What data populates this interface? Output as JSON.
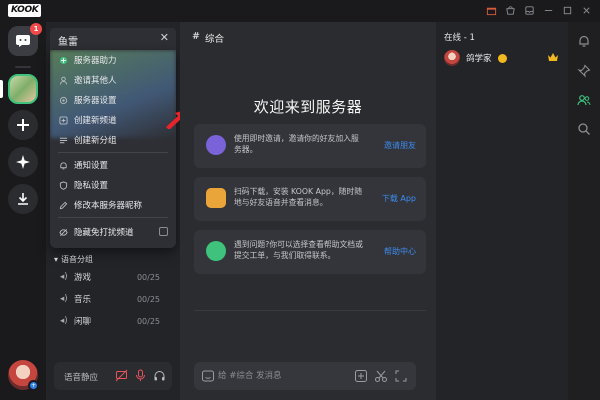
{
  "app": {
    "logo": "KOOK"
  },
  "colors": {
    "accent": "#3c8cf0",
    "online": "#3ec27c",
    "alert": "#f2494b",
    "arrow": "#e8232a"
  },
  "rail": {
    "chat_badge": "1"
  },
  "server": {
    "name": "鱼雷"
  },
  "server_menu": {
    "items": [
      {
        "label": "服务器助力",
        "icon": "boost-icon"
      },
      {
        "label": "邀请其他人",
        "icon": "invite-icon"
      },
      {
        "label": "服务器设置",
        "icon": "settings-icon"
      },
      {
        "label": "创建新频道",
        "icon": "add-channel-icon"
      },
      {
        "label": "创建新分组",
        "icon": "add-group-icon"
      },
      {
        "label": "通知设置",
        "icon": "bell-icon"
      },
      {
        "label": "隐私设置",
        "icon": "shield-icon"
      },
      {
        "label": "修改本服务器昵称",
        "icon": "edit-icon"
      },
      {
        "label": "隐藏免打扰频道",
        "icon": "eye-off-icon"
      }
    ]
  },
  "voice_group": {
    "title": "语音分组",
    "channels": [
      {
        "name": "游戏",
        "count": "00/25"
      },
      {
        "name": "音乐",
        "count": "00/25"
      },
      {
        "name": "闲聊",
        "count": "00/25"
      }
    ]
  },
  "voice_bar": {
    "label": "语音静应"
  },
  "channel": {
    "name": "综合"
  },
  "welcome": {
    "title": "欢迎来到服务器",
    "cards": [
      {
        "text": "使用即时邀请，邀请你的好友加入服务器。",
        "link": "邀请朋友",
        "icon_color": "#7a63d8"
      },
      {
        "text": "扫码下载，安装 KOOK App，随时随地与好友语音并查看消息。",
        "link": "下载 App",
        "icon_color": "#e9a53a"
      },
      {
        "text": "遇到问题?你可以选择查看帮助文档或提交工单，与我们取得联系。",
        "link": "帮助中心",
        "icon_color": "#3ec27c"
      }
    ]
  },
  "composer": {
    "placeholder": "给 #综合 发消息"
  },
  "members": {
    "online_label": "在线 - 1",
    "list": [
      {
        "name": "鸽学家"
      }
    ]
  }
}
